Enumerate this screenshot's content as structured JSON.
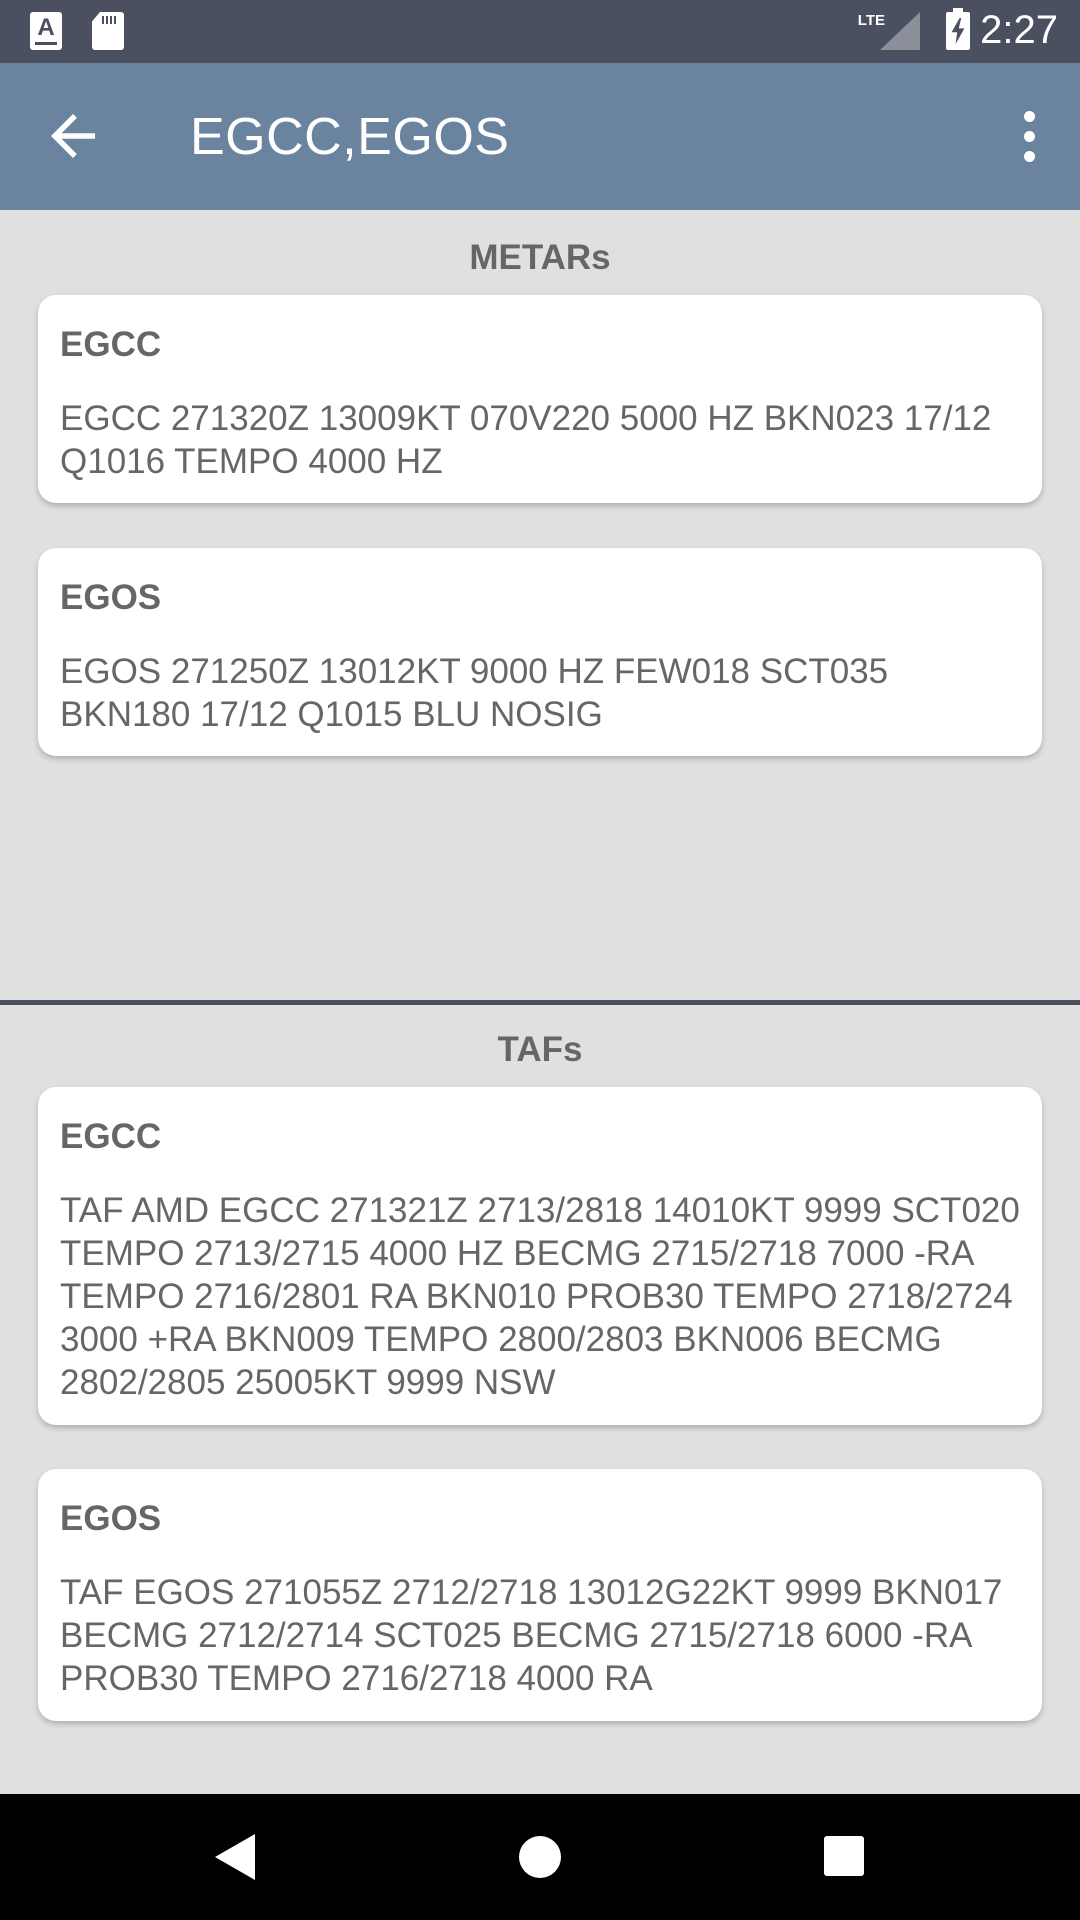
{
  "status_bar": {
    "network": "LTE",
    "time": "2:27"
  },
  "app_bar": {
    "title": "EGCC,EGOS"
  },
  "metars": {
    "heading": "METARs",
    "cards": [
      {
        "station": "EGCC",
        "text": "EGCC 271320Z 13009KT 070V220 5000 HZ BKN023 17/12 Q1016 TEMPO 4000 HZ"
      },
      {
        "station": "EGOS",
        "text": "EGOS 271250Z 13012KT 9000 HZ FEW018 SCT035 BKN180 17/12 Q1015 BLU NOSIG"
      }
    ]
  },
  "tafs": {
    "heading": "TAFs",
    "cards": [
      {
        "station": "EGCC",
        "text": "TAF AMD EGCC 271321Z 2713/2818 14010KT 9999 SCT020 TEMPO 2713/2715 4000 HZ BECMG 2715/2718 7000 -RA TEMPO 2716/2801 RA BKN010 PROB30 TEMPO 2718/2724 3000 +RA BKN009 TEMPO 2800/2803 BKN006 BECMG 2802/2805 25005KT 9999 NSW"
      },
      {
        "station": "EGOS",
        "text": "TAF EGOS 271055Z 2712/2718 13012G22KT 9999 BKN017 BECMG 2712/2714 SCT025 BECMG 2715/2718 6000 -RA PROB30 TEMPO 2716/2718 4000 RA"
      }
    ]
  },
  "colors": {
    "status_bar": "#4a5060",
    "app_bar": "#6a84a0",
    "background": "#e0e0e0",
    "text_gray": "#666666"
  }
}
